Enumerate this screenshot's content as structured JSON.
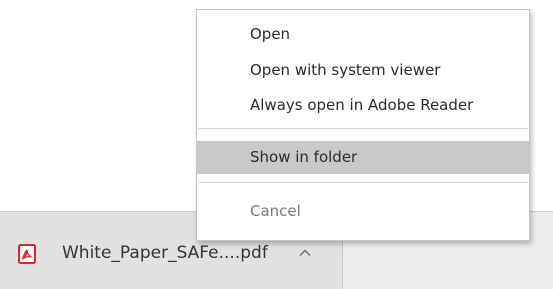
{
  "context_menu": {
    "items": [
      {
        "label": "Open",
        "state": "normal"
      },
      {
        "label": "Open with system viewer",
        "state": "normal"
      },
      {
        "label": "Always open in Adobe Reader",
        "state": "normal"
      },
      {
        "label": "Show in folder",
        "state": "highlighted"
      },
      {
        "label": "Cancel",
        "state": "disabled"
      }
    ]
  },
  "download_shelf": {
    "item": {
      "file_name": "White_Paper_SAFe....pdf",
      "icon": "pdf-icon",
      "menu_icon": "chevron-up-icon"
    }
  },
  "colors": {
    "pdf_red": "#e0252b",
    "highlight": "#c9c9c9",
    "shelf_background": "#eeeeee"
  }
}
